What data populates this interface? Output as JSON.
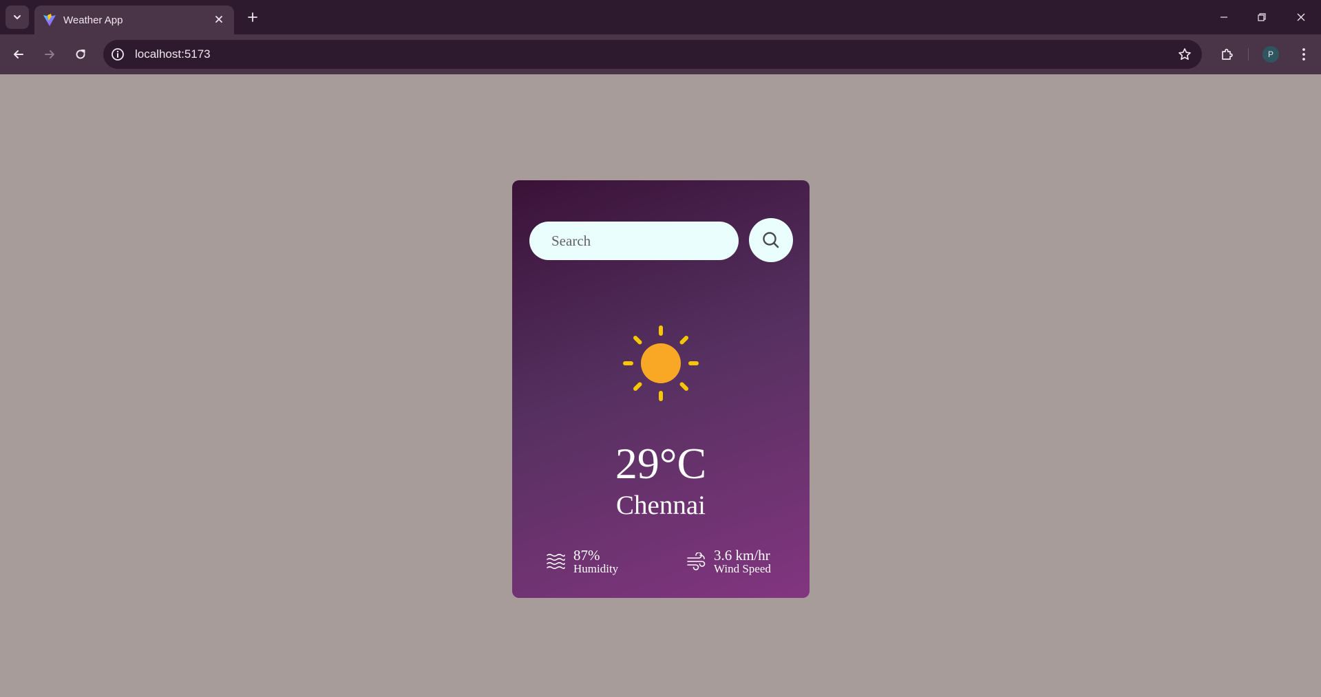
{
  "browser": {
    "tab_title": "Weather App",
    "url": "localhost:5173",
    "profile_initial": "P"
  },
  "weather": {
    "search_placeholder": "Search",
    "condition_icon": "sun-icon",
    "temperature": "29°C",
    "city": "Chennai",
    "humidity": {
      "value": "87%",
      "label": "Humidity"
    },
    "wind": {
      "value": "3.6 km/hr",
      "label": "Wind Speed"
    }
  },
  "colors": {
    "page_background": "#a89c9b",
    "card_gradient_top": "#3a1238",
    "card_gradient_bottom": "#82357f",
    "search_background": "#ebfefe",
    "sun_core": "#f9a825",
    "sun_rays": "#f7c600"
  }
}
